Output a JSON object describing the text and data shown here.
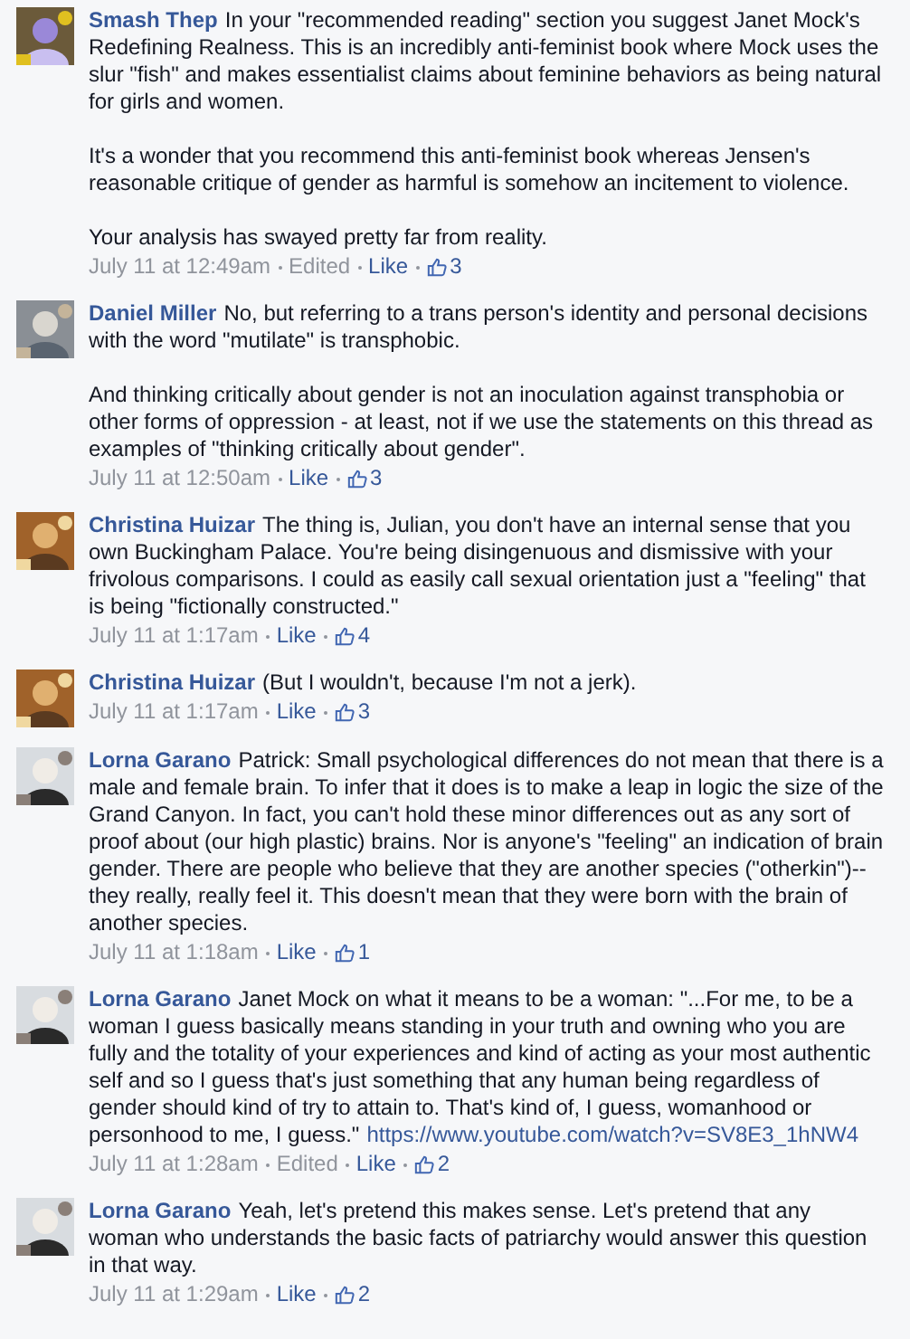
{
  "comments": [
    {
      "author": "Smash Thep",
      "avatar": {
        "kind": "picture"
      },
      "paragraphs": [
        {
          "text": "In your \"recommended reading\" section you suggest Janet Mock's Redefining Realness. This is an incredibly anti-feminist book where Mock uses the slur \"fish\" and makes essentialist claims about feminine behaviors as being natural for girls and women."
        },
        {
          "text": "It's a wonder that you recommend this anti-feminist book whereas Jensen's reasonable critique of gender as harmful is somehow an incitement to violence."
        },
        {
          "text": "Your analysis has swayed pretty far from reality."
        }
      ],
      "time": "July 11 at 12:49am",
      "edited": "Edited",
      "like": "Like",
      "likes": "3"
    },
    {
      "author": "Daniel Miller",
      "avatar": {
        "kind": "picture"
      },
      "paragraphs": [
        {
          "text": "No, but referring to a trans person's identity and personal decisions with the word \"mutilate\" is transphobic."
        },
        {
          "text": "And thinking critically about gender is not an inoculation against transphobia or other forms of oppression - at least, not if we use the statements on this thread as examples of \"thinking critically about gender\"."
        }
      ],
      "time": "July 11 at 12:50am",
      "like": "Like",
      "likes": "3"
    },
    {
      "author": "Christina Huizar",
      "avatar": {
        "kind": "picture"
      },
      "paragraphs": [
        {
          "text": "The thing is, Julian, you don't have an internal sense that you own Buckingham Palace. You're being disingenuous and dismissive with your frivolous comparisons. I could as easily call sexual orientation just a \"feeling\" that is being \"fictionally constructed.\""
        }
      ],
      "time": "July 11 at 1:17am",
      "like": "Like",
      "likes": "4"
    },
    {
      "author": "Christina Huizar",
      "avatar": {
        "kind": "picture"
      },
      "paragraphs": [
        {
          "text": "(But I wouldn't, because I'm not a jerk)."
        }
      ],
      "time": "July 11 at 1:17am",
      "like": "Like",
      "likes": "3"
    },
    {
      "author": "Lorna Garano",
      "avatar": {
        "kind": "picture"
      },
      "paragraphs": [
        {
          "text": "Patrick: Small psychological differences do not mean that there is a male and female brain. To infer that it does is to make a leap in logic the size of the Grand Canyon. In fact, you can't hold these minor differences out as any sort of proof about (our high plastic) brains. Nor is anyone's \"feeling\" an indication of brain gender. There are people who believe that they are another species (\"otherkin\")--they really, really feel it. This doesn't mean that they were born with the brain of another species."
        }
      ],
      "time": "July 11 at 1:18am",
      "like": "Like",
      "likes": "1"
    },
    {
      "author": "Lorna Garano",
      "avatar": {
        "kind": "picture"
      },
      "paragraphs": [
        {
          "text": "Janet Mock on what it means to be a woman: \"...For me, to be a woman I guess basically means standing in your truth and owning who you are fully and the totality of your experiences and kind of acting as your most authentic self and so I guess that's just something that any human being regardless of gender should kind of try to attain to. That's kind of, I guess, womanhood or personhood to me, I guess.\"",
          "link": "https://www.youtube.com/watch?v=SV8E3_1hNW4"
        }
      ],
      "time": "July 11 at 1:28am",
      "edited": "Edited",
      "like": "Like",
      "likes": "2"
    },
    {
      "author": "Lorna Garano",
      "avatar": {
        "kind": "picture"
      },
      "paragraphs": [
        {
          "text": "Yeah, let's pretend this makes sense. Let's pretend that any woman who understands the basic facts of patriarchy would answer this question in that way."
        }
      ],
      "time": "July 11 at 1:29am",
      "like": "Like",
      "likes": "2"
    }
  ]
}
